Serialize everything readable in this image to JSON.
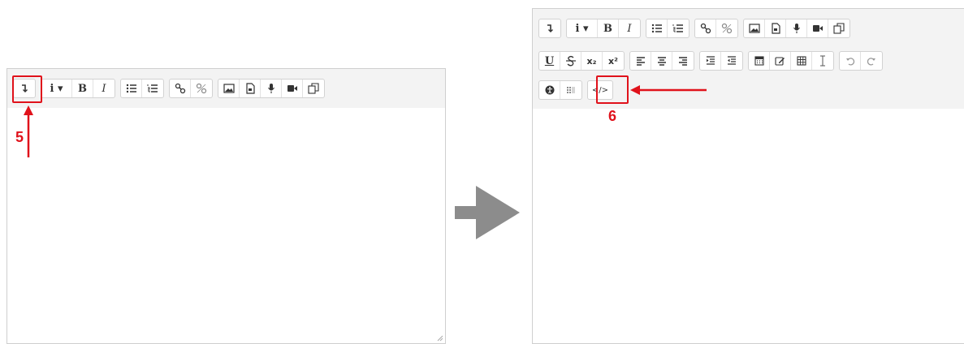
{
  "left_editor": {
    "toolbar_groups": [
      [
        "expand-toolbar-icon"
      ],
      [
        "paragraph-styles-icon",
        "bold-icon",
        "italic-icon"
      ],
      [
        "unordered-list-icon",
        "ordered-list-icon"
      ],
      [
        "link-icon",
        "unlink-icon"
      ],
      [
        "image-icon",
        "media-icon",
        "record-audio-icon",
        "record-video-icon",
        "manage-files-icon"
      ]
    ],
    "labels": {
      "paragraph": "i ▾",
      "bold": "B",
      "italic": "I"
    }
  },
  "right_editor": {
    "labels": {
      "paragraph": "i ▾",
      "bold": "B",
      "italic": "I",
      "underline": "U",
      "subscript": "x₂",
      "superscript": "x²",
      "html": "</>"
    }
  },
  "annotations": {
    "step_5": "5",
    "step_6": "6",
    "accent_color": "#e0121b"
  },
  "transition_arrow_color": "#8c8c8c"
}
